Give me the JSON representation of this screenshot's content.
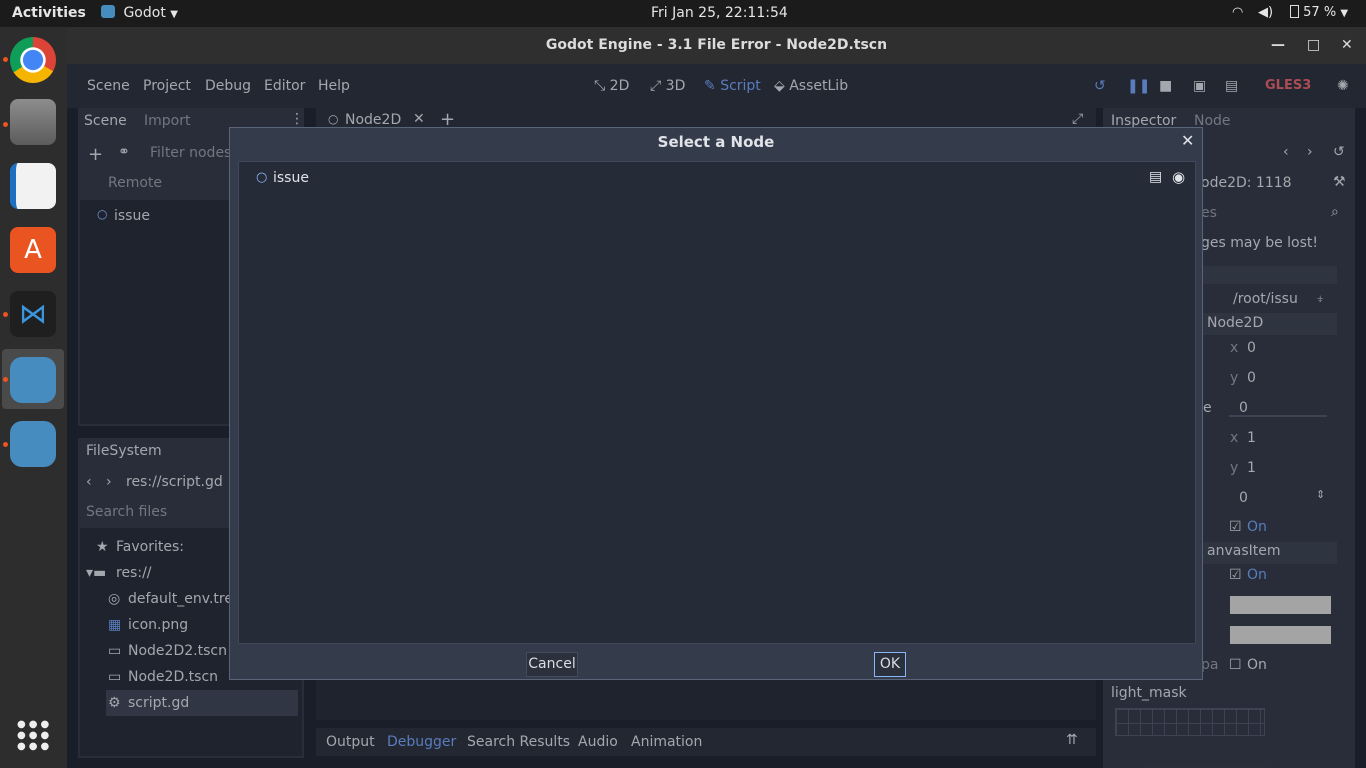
{
  "topbar": {
    "activities": "Activities",
    "app_name": "Godot",
    "clock": "Fri Jan 25, 22:11:54",
    "battery": "57 %"
  },
  "window": {
    "title": "Godot Engine - 3.1 File Error - Node2D.tscn",
    "minimize": "—",
    "maximize": "□",
    "close": "✕"
  },
  "menu": {
    "items": [
      "Scene",
      "Project",
      "Debug",
      "Editor",
      "Help"
    ],
    "workspaces": [
      "2D",
      "3D",
      "Script",
      "AssetLib"
    ],
    "renderer": "GLES3"
  },
  "scene_dock": {
    "tabs": [
      "Scene",
      "Import"
    ],
    "filter_placeholder": "Filter nodes",
    "remote": "Remote",
    "root_node": "issue"
  },
  "editor_tabs": {
    "current": "Node2D"
  },
  "filesystem": {
    "tab": "FileSystem",
    "path": "res://script.gd",
    "search_placeholder": "Search files",
    "favorites": "Favorites:",
    "root": "res://",
    "files": [
      "default_env.tres",
      "icon.png",
      "Node2D2.tscn",
      "Node2D.tscn",
      "script.gd"
    ]
  },
  "bottom_tabs": [
    "Output",
    "Debugger",
    "Search Results",
    "Audio",
    "Animation"
  ],
  "inspector": {
    "tabs": [
      "Inspector",
      "Node"
    ],
    "object": "ode2D: 1118",
    "filter": "es",
    "warning": "ges may be lost!",
    "path": "/root/issu",
    "section1": "Node2D",
    "pos_x": "0",
    "pos_y": "0",
    "rotation_label": "e",
    "rotation": "0",
    "scale_x": "1",
    "scale_y": "1",
    "z_index": "0",
    "on1": "On",
    "section2": "anvasItem",
    "on2": "On",
    "on3_label": "pa",
    "on3": "On",
    "light_mask": "light_mask",
    "axis_x": "x",
    "axis_y": "y"
  },
  "dialog": {
    "title": "Select a Node",
    "close": "✕",
    "node": "issue",
    "cancel": "Cancel",
    "ok": "OK"
  },
  "colors": {
    "accent": "#6d98e6",
    "godot_blue": "#478cbf",
    "ubuntu_orange": "#e95420"
  }
}
